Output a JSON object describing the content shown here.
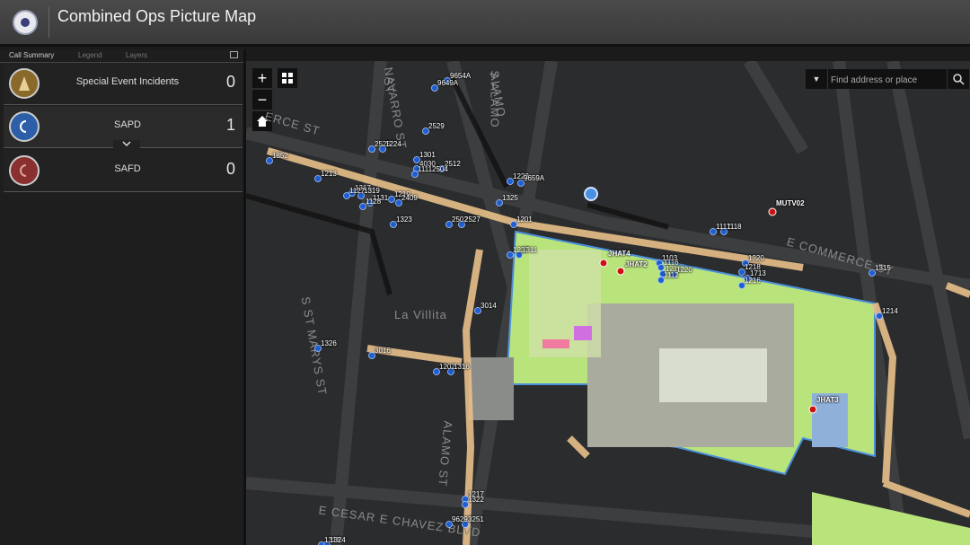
{
  "header": {
    "title": "Combined Ops Picture Map"
  },
  "panel": {
    "tabs": [
      "Call Summary",
      "Legend",
      "Layers"
    ],
    "rows": [
      {
        "label": "Special Event Incidents",
        "count": "0",
        "color": "#8a6a2a"
      },
      {
        "label": "SAPD",
        "count": "1",
        "color": "#2d5fa8"
      },
      {
        "label": "SAFD",
        "count": "0",
        "color": "#8a3030"
      }
    ]
  },
  "map": {
    "zoom_in": "+",
    "zoom_out": "−",
    "search_placeholder": "Find address or place",
    "streets": [
      "E COMMERCE ST",
      "ALAMO ST",
      "S ST MARYS ST",
      "E CESAR E CHAVEZ BLVD",
      "La Villita",
      "NAVARRO ST",
      "ALAMO",
      "ERCE ST",
      "S ALAMO",
      "ST"
    ],
    "unit_labels": [
      "9654A",
      "9649A",
      "2529",
      "2525",
      "1224",
      "1301",
      "4030",
      "2512",
      "11112504",
      "1852",
      "1213",
      "1317",
      "1319",
      "1219",
      "2409",
      "1127",
      "1131",
      "1128",
      "1323",
      "2502",
      "2527",
      "1222",
      "9659A",
      "1325",
      "1201",
      "1227",
      "1311",
      "1117",
      "1118",
      "1320",
      "1103",
      "1116",
      "1211",
      "1220",
      "1112",
      "1218",
      "1713",
      "1216",
      "1315",
      "1214",
      "3014",
      "1326",
      "3016",
      "1202",
      "1316",
      "1217",
      "1322",
      "96291",
      "3251",
      "1318",
      "1324"
    ],
    "incidents": [
      "MUTV02",
      "JHAT4",
      "JHAT2",
      "JHAT3"
    ],
    "colors": {
      "unit": "#1f5fd1",
      "incident": "#cc1111",
      "event_area": "#b9e37b",
      "route": "#e8c08a"
    }
  }
}
